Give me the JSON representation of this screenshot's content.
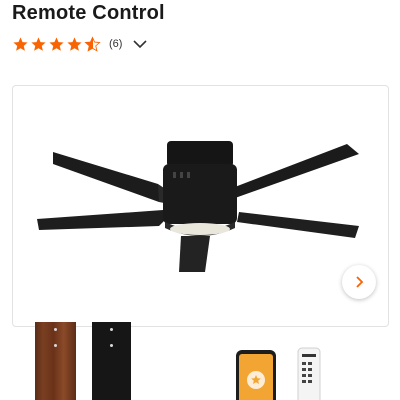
{
  "product": {
    "title": "Remote Control",
    "rating_value": 4.5,
    "review_count": "(6)"
  },
  "colors": {
    "star": "#f96302",
    "text": "#222222",
    "fan": "#1c1c1c"
  },
  "icons": {
    "rating": "star-icon",
    "expand": "chevron-down-icon",
    "next": "chevron-right-icon"
  }
}
